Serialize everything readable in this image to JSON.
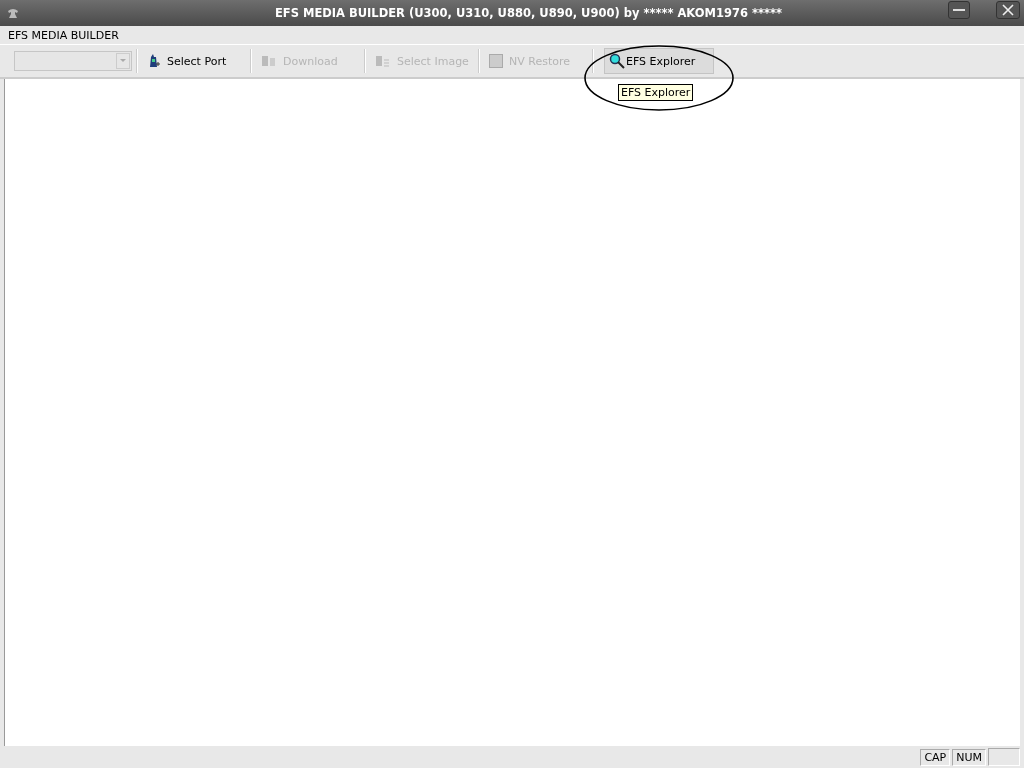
{
  "window": {
    "title": "EFS MEDIA BUILDER (U300, U310, U880, U890, U900) by ***** AKOM1976 *****"
  },
  "menu": [
    "EFS MEDIA BUILDER"
  ],
  "toolbar": {
    "combo": {
      "disabled": true
    },
    "buttons": [
      {
        "kind": "port",
        "label": "Select Port",
        "disabled": false,
        "hovered": false
      },
      {
        "kind": "download",
        "label": "Download",
        "disabled": true,
        "hovered": false
      },
      {
        "kind": "image",
        "label": "Select Image",
        "disabled": true,
        "hovered": false
      },
      {
        "kind": "restore",
        "label": "NV Restore",
        "disabled": true,
        "hovered": false
      },
      {
        "kind": "explorer",
        "label": "EFS Explorer",
        "disabled": false,
        "hovered": true
      }
    ]
  },
  "tooltip": {
    "text": "EFS Explorer"
  },
  "status_bar": [
    "CAP",
    "NUM"
  ]
}
